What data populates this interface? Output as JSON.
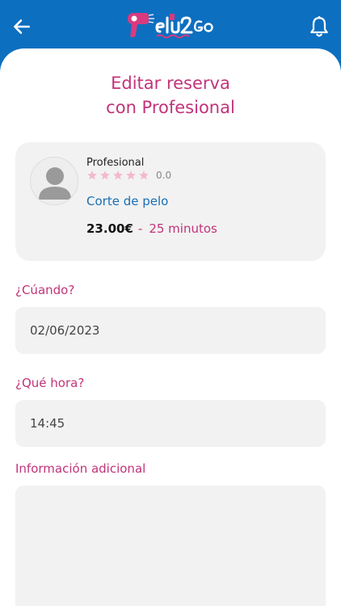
{
  "header": {
    "back_icon": "arrow-left-icon",
    "logo_text": "Pelu2Go",
    "notification_icon": "bell-icon",
    "bar_color": "#0d6fc0"
  },
  "page": {
    "title_line1": "Editar reserva",
    "title_line2": "con Profesional",
    "accent_color": "#c2337a"
  },
  "booking_card": {
    "professional_label": "Profesional",
    "rating_value": "0.0",
    "stars_total": 5,
    "stars_filled": 0,
    "service_name": "Corte de pelo",
    "price": "23.00€",
    "separator": "-",
    "duration": "25  minutos"
  },
  "form": {
    "date_label": "¿Cúando?",
    "date_value": "02/06/2023",
    "time_label": "¿Qué hora?",
    "time_value": "14:45",
    "info_label": "Información adicional",
    "info_value": ""
  }
}
